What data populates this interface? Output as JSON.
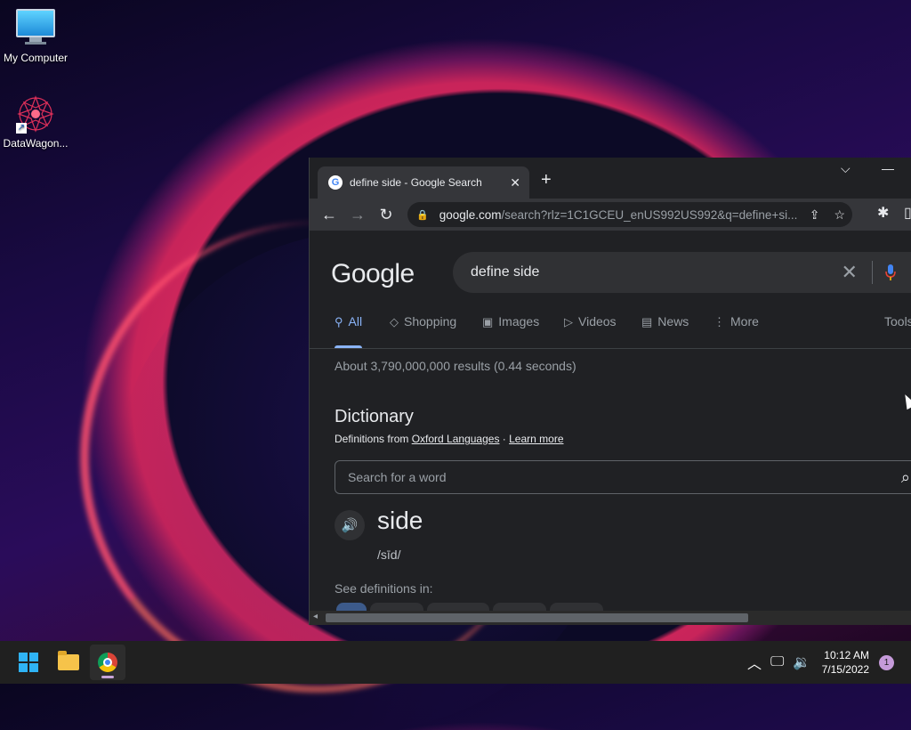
{
  "desktop": {
    "icons": [
      {
        "label": "My Computer",
        "icon": "monitor-icon"
      },
      {
        "label": "DataWagon...",
        "icon": "mandala-icon"
      }
    ]
  },
  "browser": {
    "tab_title": "define side - Google Search",
    "tab_close": "✕",
    "new_tab": "+",
    "url_host": "google.com",
    "url_path": "/search?rlz=1C1GCEU_enUS992US992&q=define+si...",
    "page": {
      "logo": "Google",
      "query": "define side",
      "search_tabs": [
        {
          "label": "All",
          "icon": "search-icon",
          "active": true
        },
        {
          "label": "Shopping",
          "icon": "tag-icon"
        },
        {
          "label": "Images",
          "icon": "image-icon"
        },
        {
          "label": "Videos",
          "icon": "play-icon"
        },
        {
          "label": "News",
          "icon": "news-icon"
        },
        {
          "label": "More",
          "icon": "more-vert-icon"
        },
        {
          "label": "Tools",
          "icon": ""
        }
      ],
      "result_stats": "About 3,790,000,000 results (0.44 seconds)",
      "dictionary": {
        "title": "Dictionary",
        "source_prefix": "Definitions from ",
        "source_link": "Oxford Languages",
        "separator": " · ",
        "learn_more": "Learn more",
        "word_search_placeholder": "Search for a word",
        "word": "side",
        "pronunciation": "/sīd/",
        "see_definitions": "See definitions in:"
      }
    }
  },
  "taskbar": {
    "time": "10:12 AM",
    "date": "7/15/2022",
    "notification_count": "1"
  }
}
